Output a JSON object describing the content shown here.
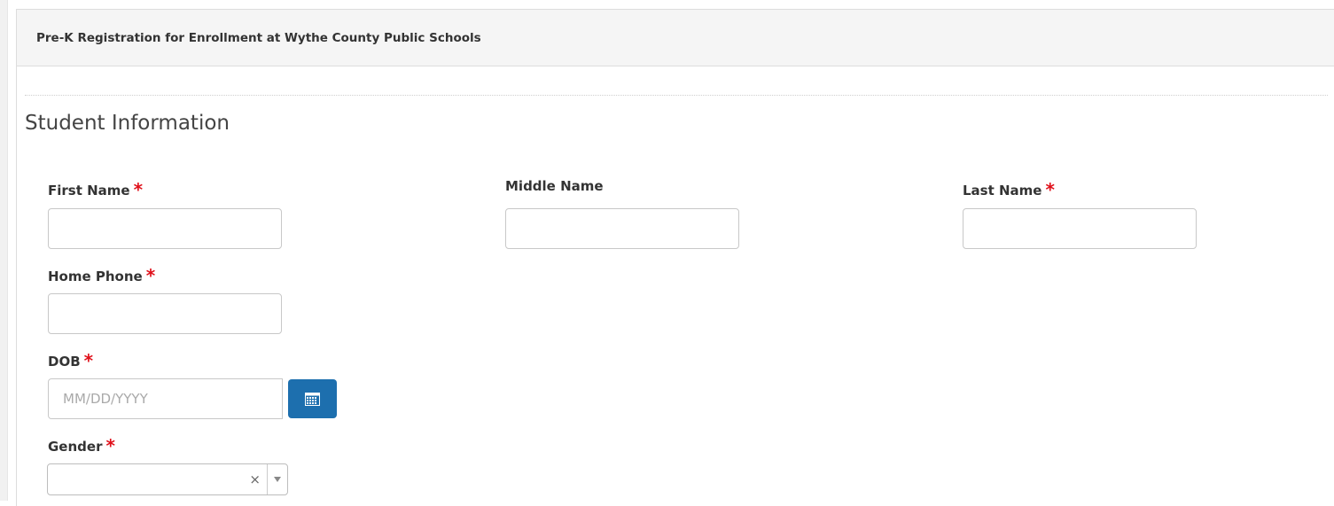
{
  "panel": {
    "title": "Pre-K Registration for Enrollment at Wythe County Public Schools"
  },
  "section": {
    "title": "Student Information"
  },
  "fields": {
    "first_name": {
      "label": "First Name",
      "required_mark": "*",
      "value": ""
    },
    "middle_name": {
      "label": "Middle Name",
      "value": ""
    },
    "last_name": {
      "label": "Last Name",
      "required_mark": "*",
      "value": ""
    },
    "home_phone": {
      "label": "Home Phone",
      "required_mark": "*",
      "value": ""
    },
    "dob": {
      "label": "DOB",
      "required_mark": "*",
      "value": "",
      "placeholder": "MM/DD/YYYY"
    },
    "gender": {
      "label": "Gender",
      "required_mark": "*",
      "selected": "",
      "clear_glyph": "×"
    }
  },
  "icons": {
    "calendar_button": "calendar-icon",
    "select_arrow": "chevron-down-icon",
    "select_clear": "close-icon"
  },
  "colors": {
    "required": "#e0101a",
    "calendar_button_bg": "#1d6fae",
    "header_bg": "#f5f5f5"
  }
}
